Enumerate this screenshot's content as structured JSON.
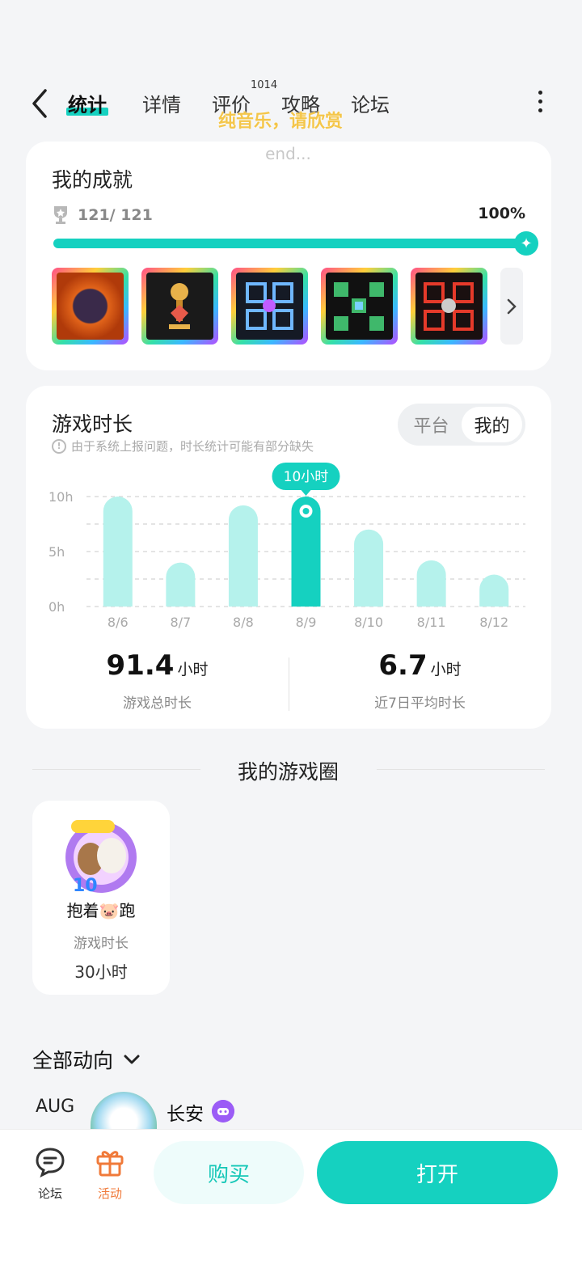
{
  "nav": {
    "tabs": [
      {
        "label": "统计",
        "active": true
      },
      {
        "label": "详情"
      },
      {
        "label": "评价"
      },
      {
        "label": "攻略"
      },
      {
        "label": "论坛"
      }
    ],
    "review_count": "1014",
    "overlay_lyric": "纯音乐，请欣赏",
    "overlay_end": "end..."
  },
  "achievements": {
    "title": "我的成就",
    "count": "121/ 121",
    "percent": "100%",
    "progress_fraction": 1.0
  },
  "playtime": {
    "title": "游戏时长",
    "notice": "由于系统上报问题，时长统计可能有部分缺失",
    "toggle": [
      "平台",
      "我的"
    ],
    "toggle_selected": "我的",
    "tooltip": "10小时",
    "total_value": "91.4",
    "total_unit": "小时",
    "total_label": "游戏总时长",
    "avg_value": "6.7",
    "avg_unit": "小时",
    "avg_label": "近7日平均时长"
  },
  "chart_data": {
    "type": "bar",
    "categories": [
      "8/6",
      "8/7",
      "8/8",
      "8/9",
      "8/10",
      "8/11",
      "8/12"
    ],
    "values": [
      10,
      4,
      9.2,
      10,
      7,
      4.2,
      2.9
    ],
    "highlighted": "8/9",
    "yticks": [
      "10h",
      "5h",
      "0h"
    ],
    "ylim": [
      0,
      10
    ],
    "colors": {
      "bar": "#b5f2ec",
      "highlight": "#15d1c0",
      "grid": "#dcdcdc"
    }
  },
  "circle": {
    "section_title": "我的游戏圈",
    "name": "抱着🐷跑",
    "sub_label": "游戏时长",
    "time": "30小时"
  },
  "feed": {
    "title": "全部动向",
    "month": "AUG",
    "user": "长安"
  },
  "bottom": {
    "forum_label": "论坛",
    "activity_label": "活动",
    "buy_label": "购买",
    "open_label": "打开",
    "accent": "#15d1c0",
    "activity_color": "#f07a3a"
  }
}
